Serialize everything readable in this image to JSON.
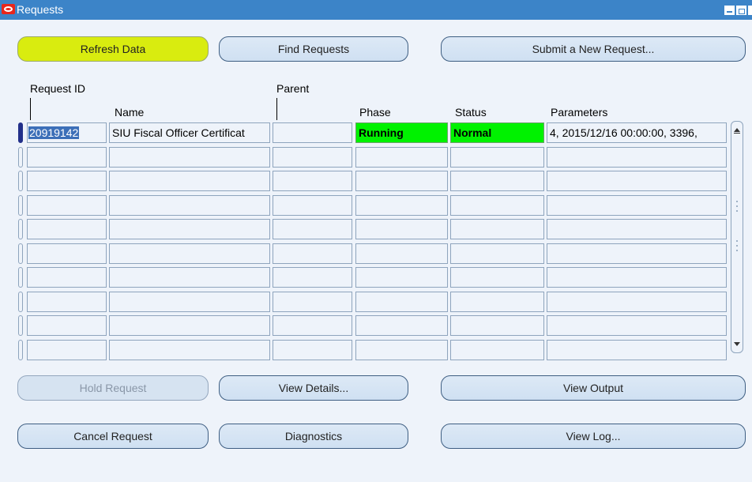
{
  "window": {
    "title": "Requests"
  },
  "buttons": {
    "refresh": "Refresh Data",
    "find": "Find Requests",
    "submit": "Submit a New Request...",
    "hold": "Hold Request",
    "view_details": "View Details...",
    "view_output": "View Output",
    "cancel": "Cancel Request",
    "diagnostics": "Diagnostics",
    "view_log": "View Log..."
  },
  "columns": {
    "request_id": "Request ID",
    "parent": "Parent",
    "name": "Name",
    "phase": "Phase",
    "status": "Status",
    "parameters": "Parameters"
  },
  "rows": [
    {
      "request_id": "20919142",
      "name": "SIU Fiscal Officer Certificat",
      "parent": "",
      "phase": "Running",
      "status": "Normal",
      "parameters": "4, 2015/12/16 00:00:00, 3396,"
    }
  ],
  "empty_row_count": 9,
  "colors": {
    "running": "#00f200",
    "highlight": "#d9ec0f",
    "titlebar": "#3c84c8"
  }
}
